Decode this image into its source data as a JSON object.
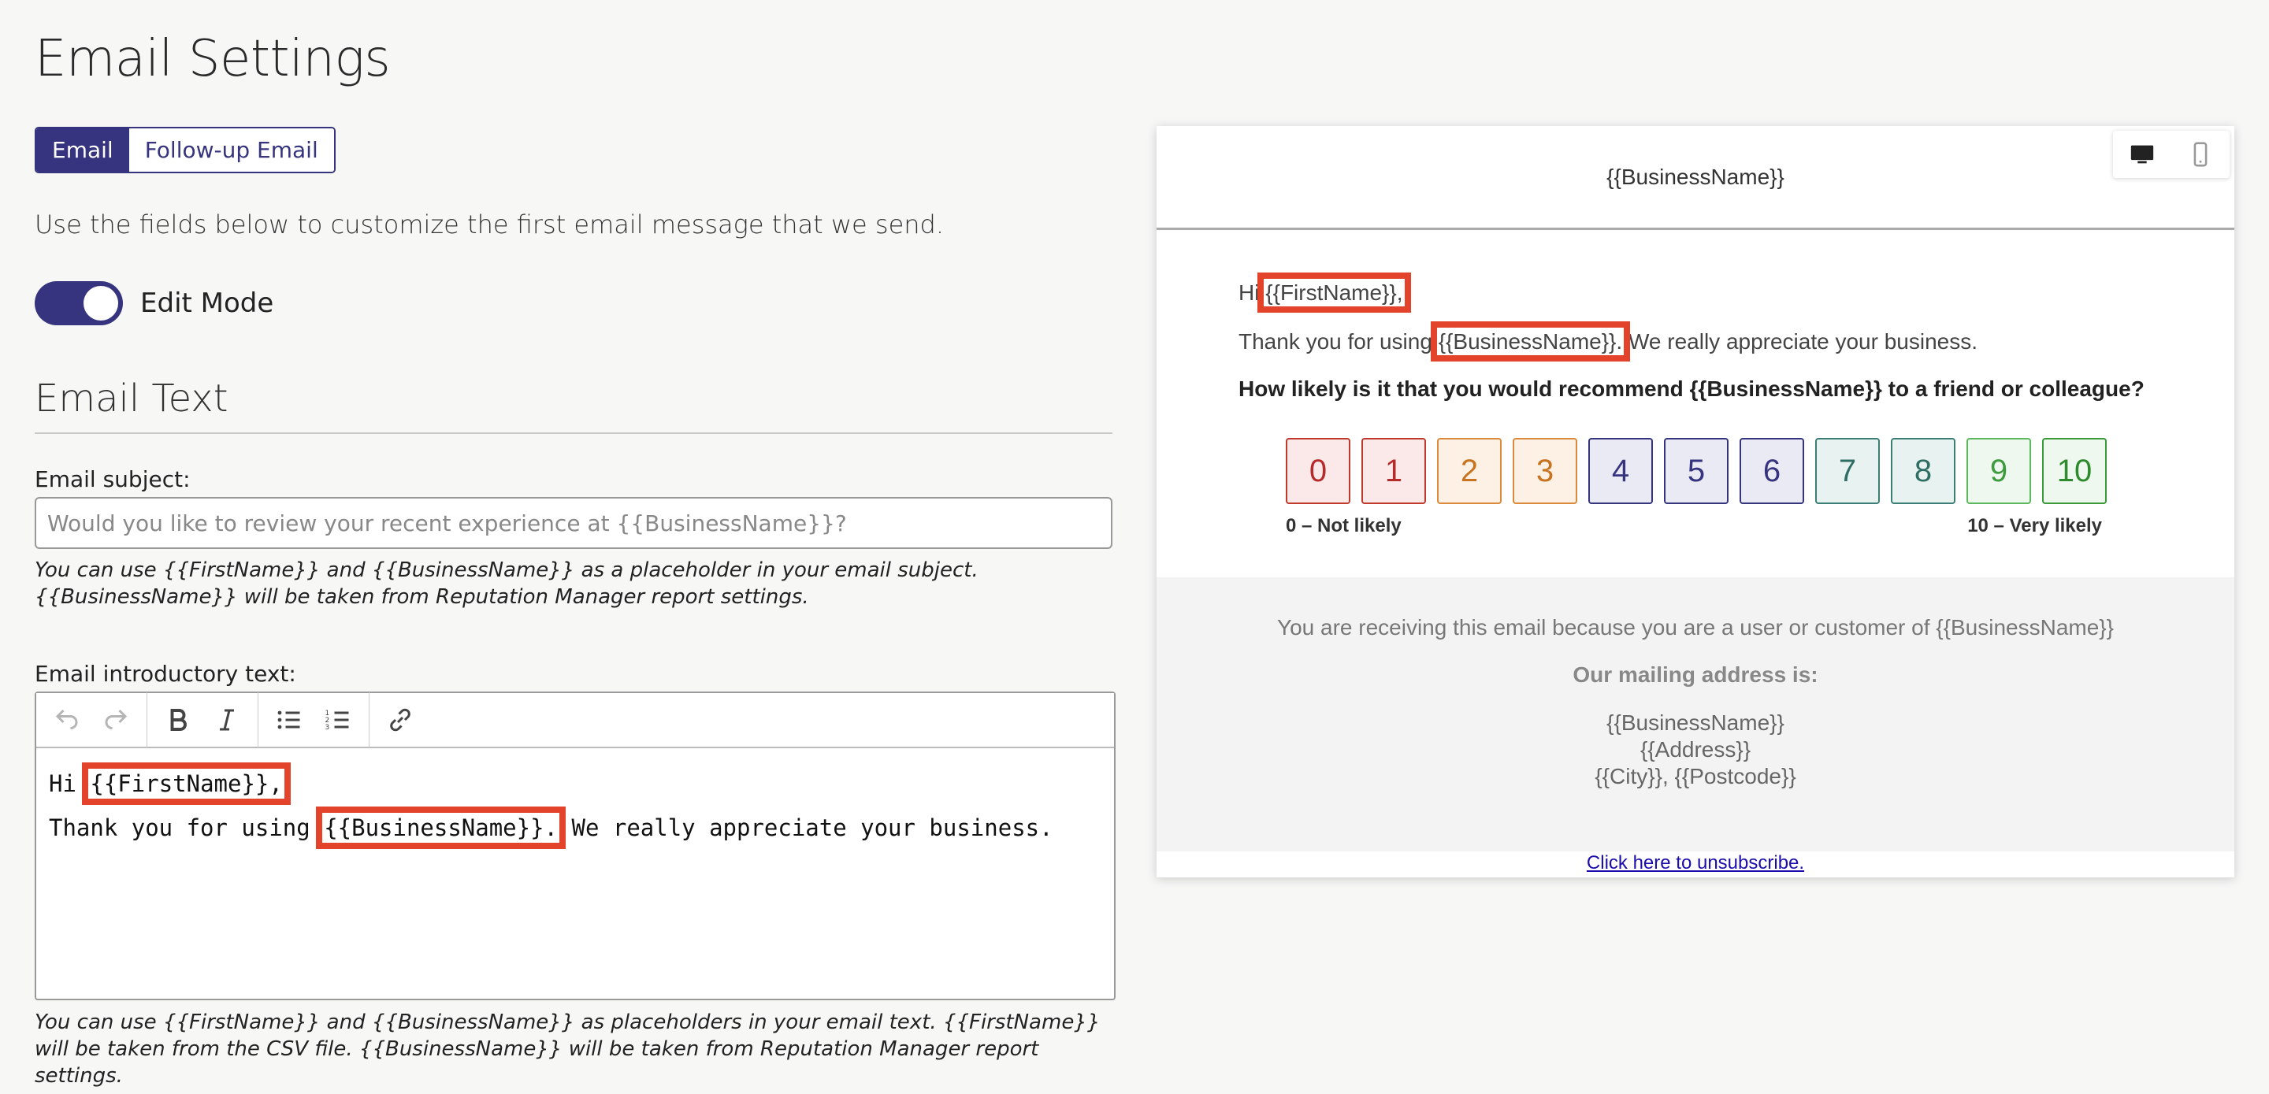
{
  "page": {
    "title": "Email Settings"
  },
  "tabs": [
    {
      "label": "Email",
      "active": true
    },
    {
      "label": "Follow-up Email",
      "active": false
    }
  ],
  "intro_text": "Use the fields below to customize the first email message that we send.",
  "edit_mode": {
    "label": "Edit Mode",
    "on": true
  },
  "email_text_section": {
    "title": "Email Text",
    "subject_label": "Email subject:",
    "subject_placeholder": "Would you like to review your recent experience at {{BusinessName}}?",
    "subject_help": "You can use {{FirstName}} and {{BusinessName}} as a placeholder in your email subject. {{BusinessName}} will be taken from Reputation Manager report settings.",
    "intro_label": "Email introductory text:",
    "intro_help": "You can use {{FirstName}} and {{BusinessName}} as placeholders in your email text. {{FirstName}} will be taken from the CSV file. {{BusinessName}} will be taken from Reputation Manager report settings."
  },
  "editor": {
    "toolbar": [
      "undo-icon",
      "redo-icon",
      "bold-icon",
      "italic-icon",
      "bullet-list-icon",
      "numbered-list-icon",
      "link-icon"
    ],
    "line1_prefix": "Hi",
    "line1_highlight": "{{FirstName}},",
    "line2_prefix": "Thank you for using",
    "line2_highlight": "{{BusinessName}}.",
    "line2_suffix": "We really appreciate your business."
  },
  "preview": {
    "header": "{{BusinessName}}",
    "line1_prefix": "Hi",
    "line1_highlight": "{{FirstName}},",
    "line2_prefix": "Thank you for using",
    "line2_highlight": "{{BusinessName}}.",
    "line2_suffix": "We really appreciate your business.",
    "question": "How likely is it that you would recommend {{BusinessName}} to a friend or colleague?",
    "scores": [
      "0",
      "1",
      "2",
      "3",
      "4",
      "5",
      "6",
      "7",
      "8",
      "9",
      "10"
    ],
    "score_colors": [
      {
        "border": "#c0392b",
        "bg": "#fbe9e9",
        "text": "#b52a2a"
      },
      {
        "border": "#c0392b",
        "bg": "#fbe9e9",
        "text": "#b52a2a"
      },
      {
        "border": "#d98a3a",
        "bg": "#fdf1e5",
        "text": "#c87320"
      },
      {
        "border": "#d98a3a",
        "bg": "#fdf1e5",
        "text": "#c87320"
      },
      {
        "border": "#36347e",
        "bg": "#eaeaf4",
        "text": "#36347e"
      },
      {
        "border": "#36347e",
        "bg": "#eaeaf4",
        "text": "#36347e"
      },
      {
        "border": "#36347e",
        "bg": "#eaeaf4",
        "text": "#36347e"
      },
      {
        "border": "#3b7f74",
        "bg": "#e8f2f0",
        "text": "#2f6e64"
      },
      {
        "border": "#3b7f74",
        "bg": "#e8f2f0",
        "text": "#2f6e64"
      },
      {
        "border": "#5cb85c",
        "bg": "#eef8ee",
        "text": "#3d9a3d"
      },
      {
        "border": "#3a9a3a",
        "bg": "#eef8ee",
        "text": "#2d8a2d"
      }
    ],
    "scale_min_label": "0 – Not likely",
    "scale_max_label": "10 – Very likely",
    "footer_receiving": "You are receiving this email because you are a user or customer of {{BusinessName}}",
    "footer_mailing_label": "Our mailing address is:",
    "footer_address": [
      "{{BusinessName}}",
      "{{Address}}",
      "{{City}}, {{Postcode}}"
    ],
    "unsubscribe": "Click here to unsubscribe.",
    "device_icons": [
      "desktop-icon",
      "mobile-icon"
    ]
  },
  "colors": {
    "accent": "#36347e",
    "highlight": "#e4432b"
  }
}
